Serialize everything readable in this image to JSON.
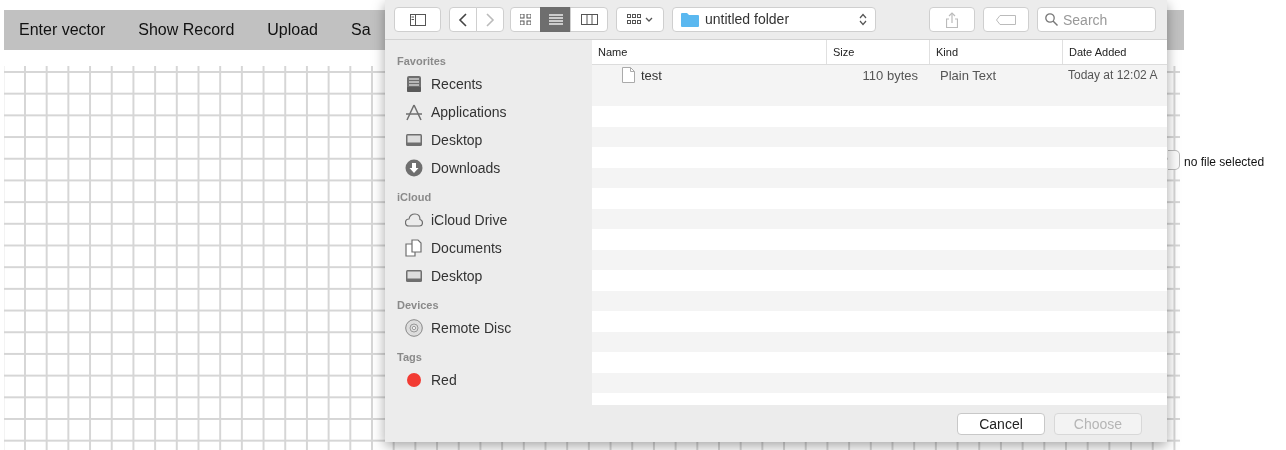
{
  "menu_bar": {
    "items": [
      "Enter vector",
      "Show Record",
      "Upload",
      "Sa"
    ]
  },
  "file_input": {
    "status": "no file selected"
  },
  "dialog": {
    "toolbar": {
      "nav": [
        {
          "kind": "back",
          "disabled": false
        },
        {
          "kind": "forward",
          "disabled": true
        }
      ],
      "view_modes": [
        {
          "kind": "icons",
          "selected": false
        },
        {
          "kind": "list",
          "selected": true
        },
        {
          "kind": "columns",
          "selected": false
        }
      ],
      "location": "untitled folder",
      "search": {
        "placeholder": "Search"
      }
    },
    "sidebar": [
      {
        "heading": "Favorites",
        "items": [
          {
            "label": "Recents",
            "kind": "recents"
          },
          {
            "label": "Applications",
            "kind": "applications"
          },
          {
            "label": "Desktop",
            "kind": "desktop"
          },
          {
            "label": "Downloads",
            "kind": "downloads"
          }
        ]
      },
      {
        "heading": "iCloud",
        "items": [
          {
            "label": "iCloud Drive",
            "kind": "cloud"
          },
          {
            "label": "Documents",
            "kind": "documents"
          },
          {
            "label": "Desktop",
            "kind": "desktop"
          }
        ]
      },
      {
        "heading": "Devices",
        "items": [
          {
            "label": "Remote Disc",
            "kind": "disc"
          }
        ]
      },
      {
        "heading": "Tags",
        "items": [
          {
            "label": "Red",
            "kind": "tag",
            "color": "#f23b33"
          }
        ]
      }
    ],
    "table": {
      "columns": [
        "Name",
        "Size",
        "Kind",
        "Date Added"
      ],
      "rows": [
        {
          "name": "test",
          "size": "110 bytes",
          "file_kind": "Plain Text",
          "date_added": "Today at 12:02 A"
        }
      ]
    },
    "buttons": [
      {
        "label": "Cancel",
        "disabled": false
      },
      {
        "label": "Choose",
        "disabled": true
      }
    ]
  }
}
